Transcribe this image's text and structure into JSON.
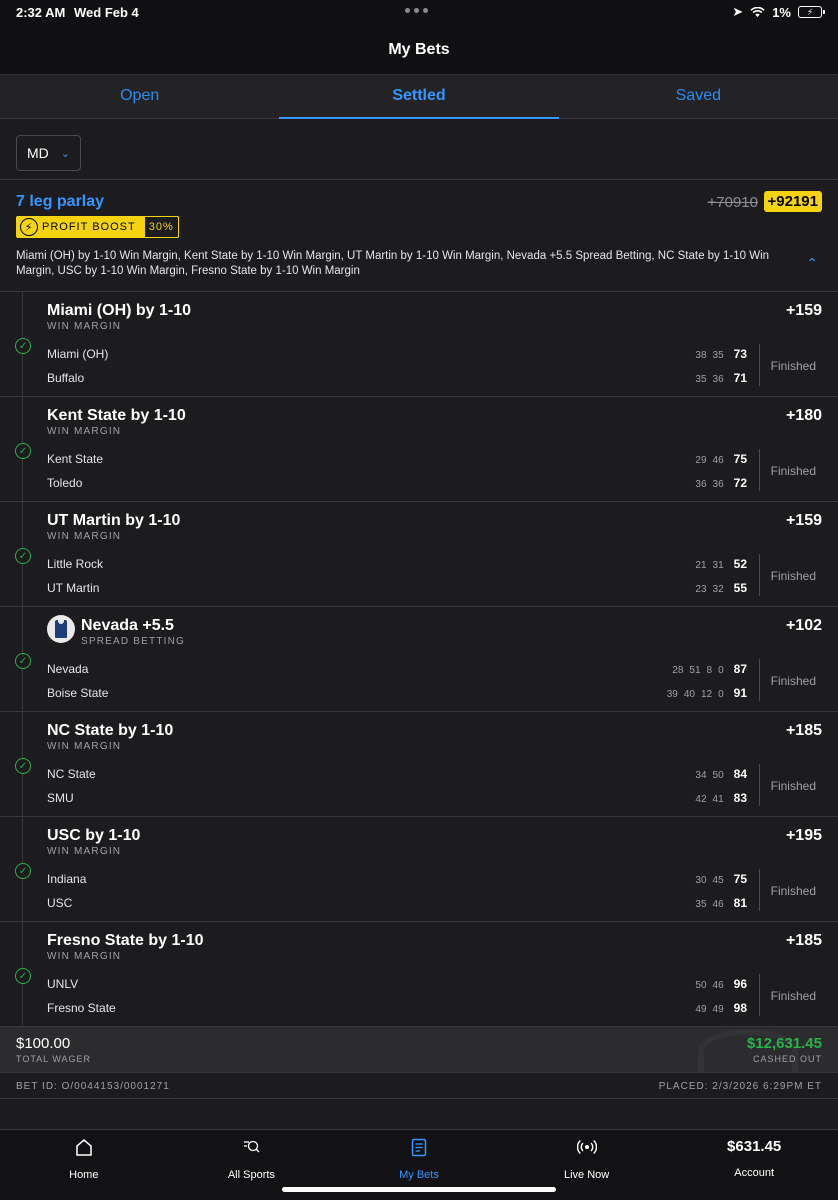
{
  "status_bar": {
    "time": "2:32 AM",
    "date": "Wed Feb 4",
    "battery": "1%"
  },
  "header": {
    "title": "My Bets"
  },
  "tabs": [
    {
      "label": "Open",
      "active": false
    },
    {
      "label": "Settled",
      "active": true
    },
    {
      "label": "Saved",
      "active": false
    }
  ],
  "filter": {
    "state": "MD"
  },
  "bet": {
    "title": "7 leg parlay",
    "odds_original": "+70910",
    "odds_boosted": "+92191",
    "boost_label": "PROFIT BOOST",
    "boost_percent": "30%",
    "summary": "Miami (OH) by 1-10 Win Margin, Kent State by 1-10 Win Margin, UT Martin by 1-10 Win Margin, Nevada +5.5 Spread Betting, NC State by 1-10 Win Margin, USC by 1-10 Win Margin, Fresno State by 1-10 Win Margin",
    "legs": [
      {
        "title": "Miami (OH) by 1-10",
        "subtitle": "WIN MARGIN",
        "odds": "+159",
        "team1": {
          "name": "Miami (OH)",
          "periods": [
            "38",
            "35"
          ],
          "total": "73"
        },
        "team2": {
          "name": "Buffalo",
          "periods": [
            "35",
            "36"
          ],
          "total": "71"
        },
        "status": "Finished"
      },
      {
        "title": "Kent State by 1-10",
        "subtitle": "WIN MARGIN",
        "odds": "+180",
        "team1": {
          "name": "Kent State",
          "periods": [
            "29",
            "46"
          ],
          "total": "75"
        },
        "team2": {
          "name": "Toledo",
          "periods": [
            "36",
            "36"
          ],
          "total": "72"
        },
        "status": "Finished"
      },
      {
        "title": "UT Martin by 1-10",
        "subtitle": "WIN MARGIN",
        "odds": "+159",
        "team1": {
          "name": "Little Rock",
          "periods": [
            "21",
            "31"
          ],
          "total": "52"
        },
        "team2": {
          "name": "UT Martin",
          "periods": [
            "23",
            "32"
          ],
          "total": "55"
        },
        "status": "Finished"
      },
      {
        "title": "Nevada +5.5",
        "subtitle": "SPREAD BETTING",
        "odds": "+102",
        "team1": {
          "name": "Nevada",
          "periods": [
            "28",
            "51",
            "8",
            "0"
          ],
          "total": "87"
        },
        "team2": {
          "name": "Boise State",
          "periods": [
            "39",
            "40",
            "12",
            "0"
          ],
          "total": "91"
        },
        "status": "Finished"
      },
      {
        "title": "NC State by 1-10",
        "subtitle": "WIN MARGIN",
        "odds": "+185",
        "team1": {
          "name": "NC State",
          "periods": [
            "34",
            "50"
          ],
          "total": "84"
        },
        "team2": {
          "name": "SMU",
          "periods": [
            "42",
            "41"
          ],
          "total": "83"
        },
        "status": "Finished"
      },
      {
        "title": "USC by 1-10",
        "subtitle": "WIN MARGIN",
        "odds": "+195",
        "team1": {
          "name": "Indiana",
          "periods": [
            "30",
            "45"
          ],
          "total": "75"
        },
        "team2": {
          "name": "USC",
          "periods": [
            "35",
            "46"
          ],
          "total": "81"
        },
        "status": "Finished"
      },
      {
        "title": "Fresno State by 1-10",
        "subtitle": "WIN MARGIN",
        "odds": "+185",
        "team1": {
          "name": "UNLV",
          "periods": [
            "50",
            "46"
          ],
          "total": "96"
        },
        "team2": {
          "name": "Fresno State",
          "periods": [
            "49",
            "49"
          ],
          "total": "98"
        },
        "status": "Finished"
      }
    ],
    "total_wager": "$100.00",
    "total_wager_label": "TOTAL WAGER",
    "cashed_out": "$12,631.45",
    "cashed_out_label": "CASHED OUT",
    "bet_id": "BET ID: O/0044153/0001271",
    "placed": "PLACED: 2/3/2026 6:29PM ET"
  },
  "nav": [
    {
      "label": "Home",
      "icon": "home-icon"
    },
    {
      "label": "All Sports",
      "icon": "search-icon"
    },
    {
      "label": "My Bets",
      "icon": "receipt-icon",
      "active": true
    },
    {
      "label": "Live Now",
      "icon": "broadcast-icon"
    },
    {
      "label": "Account",
      "balance": "$631.45"
    }
  ],
  "colors": {
    "accent": "#3596ff",
    "boost": "#f5d40f",
    "success": "#29b24a",
    "background": "#1c1c1e"
  }
}
